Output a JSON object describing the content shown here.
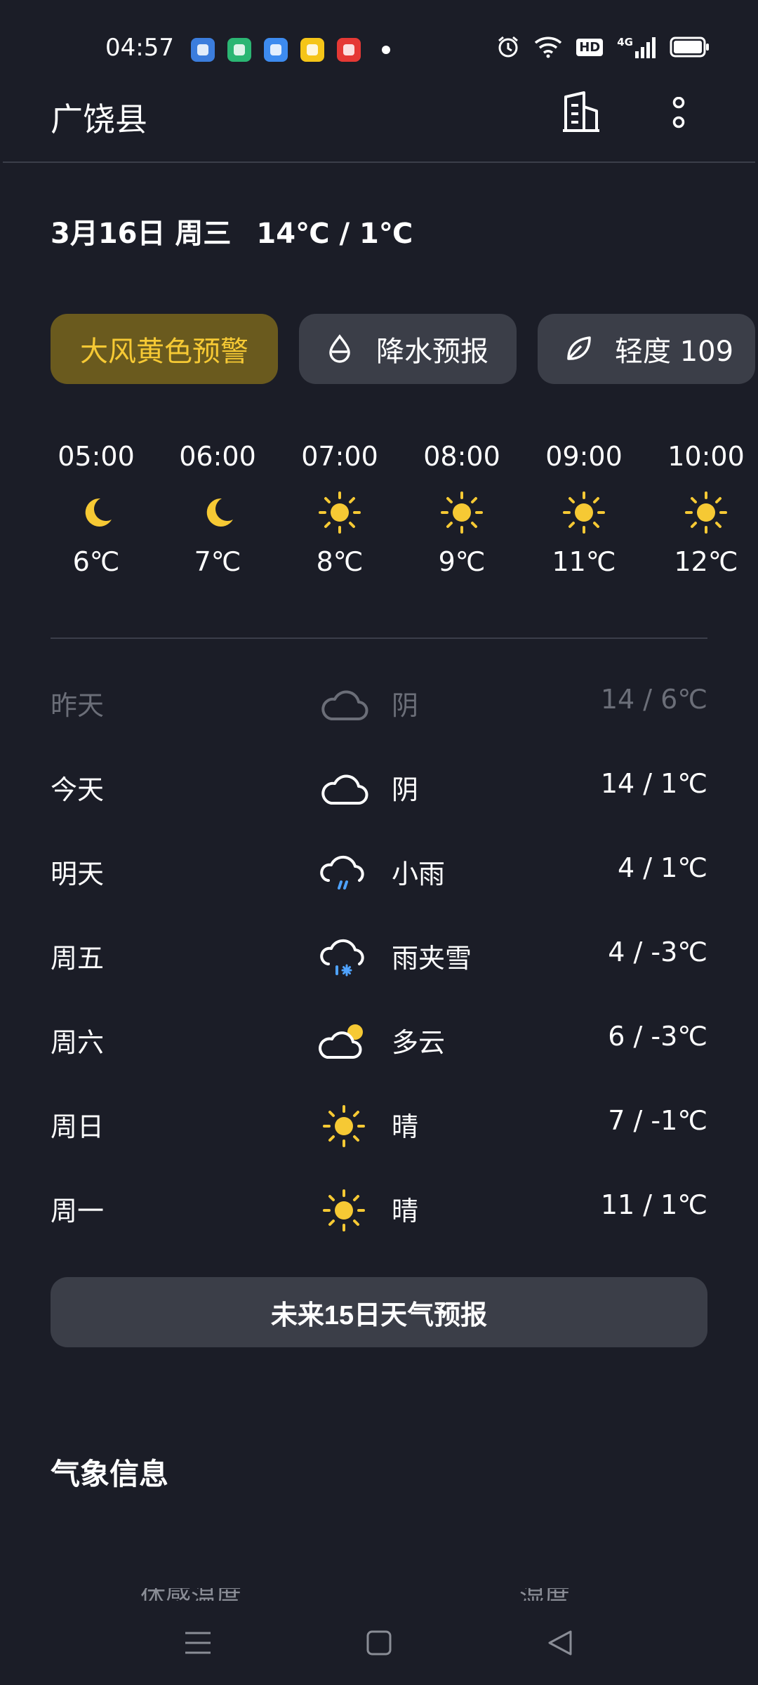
{
  "status_bar": {
    "time": "04:57",
    "notification_colors": [
      "#3b7ddd",
      "#2bb673",
      "#3d8bef",
      "#f5c518",
      "#e53935"
    ],
    "hd_label": "HD",
    "network_label": "4G"
  },
  "header": {
    "city": "广饶县"
  },
  "date_line": {
    "date": "3月16日 周三",
    "temp_range": "14℃ / 1℃"
  },
  "chips": {
    "warning": "大风黄色预警",
    "precip": "降水预报",
    "aqi": "轻度 109"
  },
  "hourly": [
    {
      "time": "05:00",
      "icon": "moon-icon",
      "temp": "6℃"
    },
    {
      "time": "06:00",
      "icon": "moon-icon",
      "temp": "7℃"
    },
    {
      "time": "07:00",
      "icon": "sun-icon",
      "temp": "8℃"
    },
    {
      "time": "08:00",
      "icon": "sun-icon",
      "temp": "9℃"
    },
    {
      "time": "09:00",
      "icon": "sun-icon",
      "temp": "11℃"
    },
    {
      "time": "10:00",
      "icon": "sun-icon",
      "temp": "12℃"
    }
  ],
  "daily": [
    {
      "day": "昨天",
      "icon": "cloud-icon",
      "cond": "阴",
      "temp": "14 / 6℃",
      "past": true
    },
    {
      "day": "今天",
      "icon": "cloud-icon",
      "cond": "阴",
      "temp": "14 / 1℃"
    },
    {
      "day": "明天",
      "icon": "rain-cloud-icon",
      "cond": "小雨",
      "temp": "4 / 1℃"
    },
    {
      "day": "周五",
      "icon": "sleet-cloud-icon",
      "cond": "雨夹雪",
      "temp": "4 / -3℃"
    },
    {
      "day": "周六",
      "icon": "partly-cloudy-icon",
      "cond": "多云",
      "temp": "6 / -3℃"
    },
    {
      "day": "周日",
      "icon": "sun-icon",
      "cond": "晴",
      "temp": "7 / -1℃"
    },
    {
      "day": "周一",
      "icon": "sun-icon",
      "cond": "晴",
      "temp": "11 / 1℃"
    }
  ],
  "forecast_button": "未来15日天气预报",
  "section": {
    "title": "气象信息",
    "partial_labels": [
      "体感温度",
      "湿度"
    ]
  },
  "colors": {
    "background": "#1b1d27",
    "accent_yellow": "#f6c934",
    "warning_bg": "#6a5a1e",
    "chip_bg": "#3b3e48",
    "rain_blue": "#4fa3ff"
  }
}
